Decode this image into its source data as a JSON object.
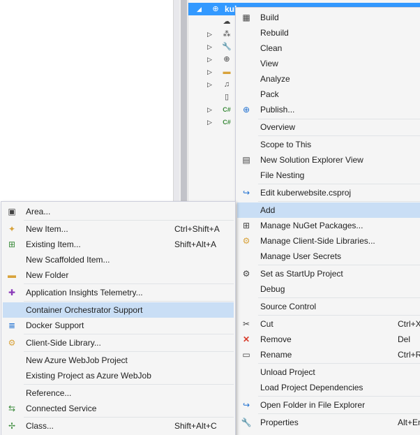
{
  "colors": {
    "selection": "#3399ff",
    "menu_bg": "#f5f5f5",
    "highlight": "#c9def5",
    "menu_border": "#cccedb",
    "tree_bg": "#f5f5f5"
  },
  "tree": {
    "selected_label": "kuber",
    "rows": [
      {
        "icon": "project-icon"
      },
      {
        "icon": "connected-services-icon"
      },
      {
        "icon": "dependencies-icon"
      },
      {
        "icon": "properties-wrench-icon"
      },
      {
        "icon": "globe-icon"
      },
      {
        "icon": "folder-icon"
      },
      {
        "icon": "music-file-icon"
      },
      {
        "icon": "file-icon"
      },
      {
        "icon": "csharp-file-icon"
      },
      {
        "icon": "csharp-file-icon"
      }
    ]
  },
  "context_menu": {
    "items": {
      "build": {
        "label": "Build"
      },
      "rebuild": {
        "label": "Rebuild"
      },
      "clean": {
        "label": "Clean"
      },
      "view": {
        "label": "View"
      },
      "analyze": {
        "label": "Analyze"
      },
      "pack": {
        "label": "Pack"
      },
      "publish": {
        "label": "Publish..."
      },
      "overview": {
        "label": "Overview"
      },
      "scope_to_this": {
        "label": "Scope to This"
      },
      "new_solution_explorer_view": {
        "label": "New Solution Explorer View"
      },
      "file_nesting": {
        "label": "File Nesting"
      },
      "edit_csproj": {
        "label": "Edit kuberwebsite.csproj"
      },
      "add": {
        "label": "Add"
      },
      "manage_nuget": {
        "label": "Manage NuGet Packages..."
      },
      "manage_client_libs": {
        "label": "Manage Client-Side Libraries..."
      },
      "manage_user_secrets": {
        "label": "Manage User Secrets"
      },
      "set_startup": {
        "label": "Set as StartUp Project"
      },
      "debug": {
        "label": "Debug"
      },
      "source_control": {
        "label": "Source Control"
      },
      "cut": {
        "label": "Cut",
        "shortcut": "Ctrl+X"
      },
      "remove": {
        "label": "Remove",
        "shortcut": "Del"
      },
      "rename": {
        "label": "Rename",
        "shortcut": "Ctrl+R"
      },
      "unload_project": {
        "label": "Unload Project"
      },
      "load_dependencies": {
        "label": "Load Project Dependencies"
      },
      "open_folder": {
        "label": "Open Folder in File Explorer"
      },
      "properties": {
        "label": "Properties",
        "shortcut": "Alt+Enter"
      }
    }
  },
  "add_submenu": {
    "items": {
      "area": {
        "label": "Area..."
      },
      "new_item": {
        "label": "New Item...",
        "shortcut": "Ctrl+Shift+A"
      },
      "existing_item": {
        "label": "Existing Item...",
        "shortcut": "Shift+Alt+A"
      },
      "new_scaffolded_item": {
        "label": "New Scaffolded Item..."
      },
      "new_folder": {
        "label": "New Folder"
      },
      "app_insights": {
        "label": "Application Insights Telemetry..."
      },
      "container_orchestrator": {
        "label": "Container Orchestrator Support"
      },
      "docker_support": {
        "label": "Docker Support"
      },
      "client_side_library": {
        "label": "Client-Side Library..."
      },
      "new_azure_webjob": {
        "label": "New Azure WebJob Project"
      },
      "existing_azure_webjob": {
        "label": "Existing Project as Azure WebJob"
      },
      "reference": {
        "label": "Reference..."
      },
      "connected_service": {
        "label": "Connected Service"
      },
      "class": {
        "label": "Class...",
        "shortcut": "Shift+Alt+C"
      }
    }
  }
}
